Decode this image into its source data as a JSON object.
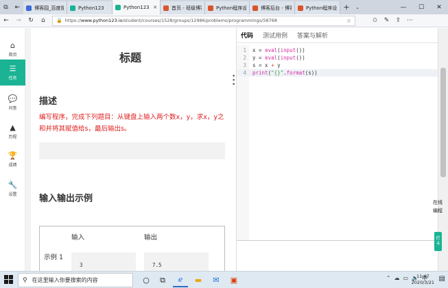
{
  "browser": {
    "tabs": [
      {
        "title": "博客园_百度搜索",
        "favicon_color": "#3b6bd6",
        "active": false
      },
      {
        "title": "Python123",
        "favicon_color": "#1ab394",
        "active": false
      },
      {
        "title": "Python123",
        "favicon_color": "#1ab394",
        "active": true
      },
      {
        "title": "首页 - 班级博客",
        "favicon_color": "#d9542b",
        "active": false
      },
      {
        "title": "Python程序设计",
        "favicon_color": "#d9542b",
        "active": false
      },
      {
        "title": "博客后台 - 博客",
        "favicon_color": "#d9542b",
        "active": false
      },
      {
        "title": "Python程序设计",
        "favicon_color": "#d9542b",
        "active": false
      }
    ],
    "new_tab": "+",
    "tab_dropdown": "⌄",
    "window_controls": {
      "minimize": "—",
      "maximize": "☐",
      "close": "✕"
    },
    "url": {
      "prefix": "https://",
      "host": "www.python123.io",
      "path": "/student/courses/1528/groups/12986/problems/programmings/58768"
    }
  },
  "sidebar": {
    "items": [
      {
        "label": "首页",
        "icon": "home-icon",
        "glyph": "⌂",
        "active": false
      },
      {
        "label": "任务",
        "icon": "tasks-icon",
        "glyph": "☰",
        "active": true
      },
      {
        "label": "问答",
        "icon": "chat-icon",
        "glyph": "💬",
        "active": false
      },
      {
        "label": "历程",
        "icon": "tree-icon",
        "glyph": "▲",
        "active": false
      },
      {
        "label": "成绩",
        "icon": "trophy-icon",
        "glyph": "🏆",
        "active": false
      },
      {
        "label": "设置",
        "icon": "wrench-icon",
        "glyph": "🔧",
        "active": false
      }
    ]
  },
  "problem": {
    "title": "标题",
    "description_heading": "描述",
    "description": "编写程序，完成下列题目：从键盘上输入两个数x，y，求x，y之和并将其赋值给s，最后输出s。",
    "io_heading": "输入输出示例",
    "io_table": {
      "input_header": "输入",
      "output_header": "输出",
      "sample_label": "示例 1",
      "sample_input": "3",
      "sample_output": "7.5"
    }
  },
  "editor": {
    "tabs": [
      "代码",
      "测试用例",
      "答案与解析"
    ],
    "active_tab": "代码",
    "lines": [
      {
        "no": "1",
        "text": "x = eval(input())"
      },
      {
        "no": "2",
        "text": "y = eval(input())"
      },
      {
        "no": "3",
        "text": "s = x + y"
      },
      {
        "no": "4",
        "text": "print(\"{}\".format(s))"
      }
    ],
    "current_line": 4
  },
  "side_widget": {
    "online": "在线编程",
    "trial": "打卡"
  },
  "taskbar": {
    "search_placeholder": "在这里输入你要搜索的内容",
    "ime": "中",
    "time": "11:47",
    "date": "2020/3/21"
  }
}
